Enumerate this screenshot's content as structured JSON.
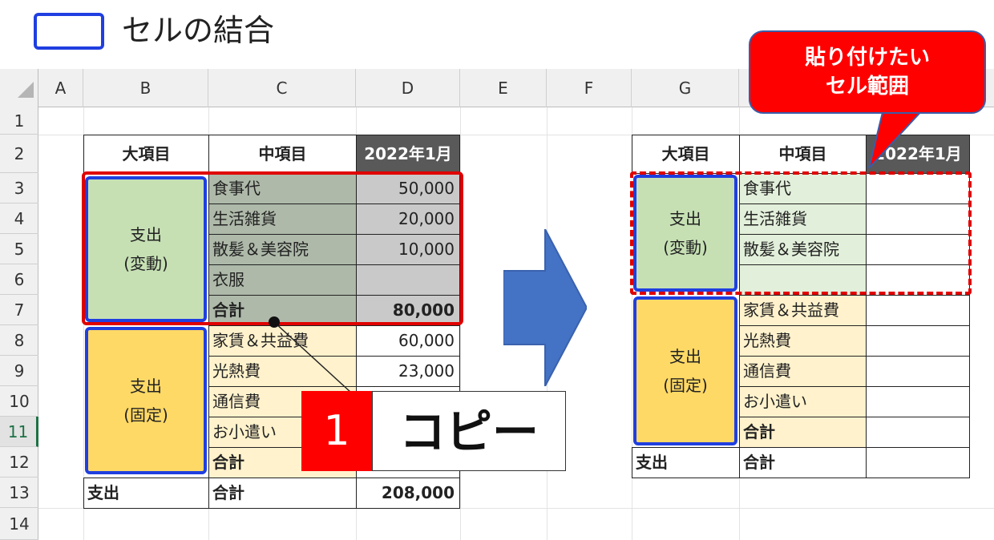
{
  "legend": {
    "label": "セルの結合",
    "box_color": "#1f3fe0"
  },
  "columns": [
    "A",
    "B",
    "C",
    "D",
    "E",
    "F",
    "G"
  ],
  "rows": [
    "1",
    "2",
    "3",
    "4",
    "5",
    "6",
    "7",
    "8",
    "9",
    "10",
    "11",
    "12",
    "13",
    "14"
  ],
  "selected_row": "11",
  "source_table": {
    "header": {
      "major": "大項目",
      "middle": "中項目",
      "month": "2022年1月"
    },
    "variable": {
      "group_label_1": "支出",
      "group_label_2": "(変動)",
      "items": [
        {
          "name": "食事代",
          "value": "50,000"
        },
        {
          "name": "生活雑貨",
          "value": "20,000"
        },
        {
          "name": "散髪＆美容院",
          "value": "10,000"
        },
        {
          "name": "衣服",
          "value": ""
        }
      ],
      "total_label": "合計",
      "total_value": "80,000"
    },
    "fixed": {
      "group_label_1": "支出",
      "group_label_2": "(固定)",
      "items": [
        {
          "name": "家賃＆共益費",
          "value": "60,000"
        },
        {
          "name": "光熱費",
          "value": "23,000"
        },
        {
          "name": "通信費",
          "value": ""
        },
        {
          "name": "お小遣い",
          "value": ""
        }
      ],
      "total_label": "合計"
    },
    "grand": {
      "label": "支出",
      "middle": "合計",
      "value": "208,000"
    }
  },
  "target_table": {
    "header": {
      "major": "大項目",
      "middle": "中項目",
      "month": "2022年1月"
    },
    "variable": {
      "group_label_1": "支出",
      "group_label_2": "(変動)",
      "items": [
        "食事代",
        "生活雑貨",
        "散髪＆美容院",
        ""
      ]
    },
    "fixed": {
      "group_label_1": "支出",
      "group_label_2": "(固定)",
      "items": [
        "家賃＆共益費",
        "光熱費",
        "通信費",
        "お小遣い"
      ],
      "total_label": "合計"
    },
    "grand": {
      "label": "支出",
      "middle": "合計"
    }
  },
  "callout": {
    "line1": "貼り付けたい",
    "line2": "セル範囲"
  },
  "step": {
    "number": "1",
    "label": "コピー"
  },
  "colors": {
    "highlight": "#e00000",
    "arrow": "#4472c4",
    "merge_border": "#1f3fe0"
  }
}
